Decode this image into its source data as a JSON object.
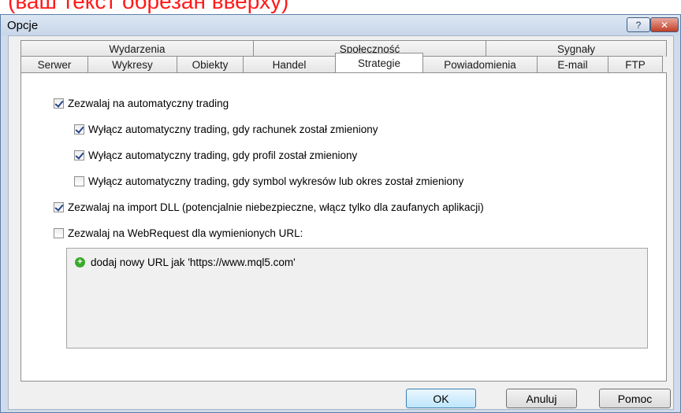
{
  "top_overlay_text": "(ваш текст обрезан вверху)",
  "window": {
    "title": "Opcje",
    "help_glyph": "?",
    "close_glyph": "✕"
  },
  "tabs": {
    "row1": [
      "Wydarzenia",
      "Społeczność",
      "Sygnały"
    ],
    "row2": [
      "Serwer",
      "Wykresy",
      "Obiekty",
      "Handel",
      "Strategie",
      "Powiadomienia",
      "E-mail",
      "FTP"
    ],
    "active": "Strategie"
  },
  "options": [
    {
      "label": "Zezwalaj na automatyczny trading",
      "checked": true
    },
    {
      "label": "Wyłącz automatyczny trading, gdy rachunek został zmieniony",
      "checked": true
    },
    {
      "label": "Wyłącz automatyczny trading, gdy profil został zmieniony",
      "checked": true
    },
    {
      "label": "Wyłącz automatyczny trading, gdy symbol wykresów lub okres został zmieniony",
      "checked": false
    },
    {
      "label": "Zezwalaj na import DLL (potencjalnie niebezpieczne, włącz tylko dla zaufanych aplikacji)",
      "checked": true
    },
    {
      "label": "Zezwalaj na WebRequest dla wymienionych URL:",
      "checked": false
    }
  ],
  "url_list": {
    "add_item": "dodaj nowy URL jak 'https://www.mql5.com'",
    "add_icon": "plus-circle-icon"
  },
  "buttons": {
    "ok": "OK",
    "cancel": "Anuluj",
    "help": "Pomoc"
  }
}
